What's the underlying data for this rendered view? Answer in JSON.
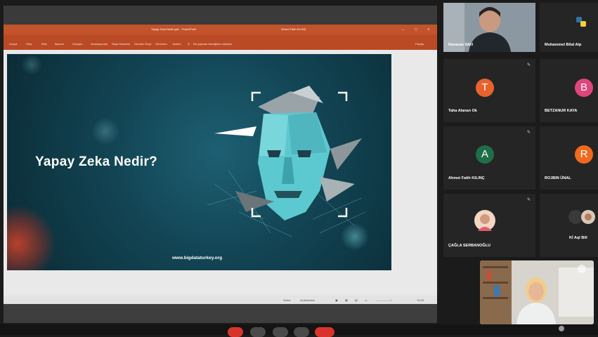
{
  "powerpoint": {
    "title_center": "Yapay Zeka Nedir.pptx - PowerPoint",
    "title_right": "Ahmet Fatih KILINÇ",
    "ribbon_tabs": [
      "Dosya",
      "Giriş",
      "Ekle",
      "Tasarım",
      "Geçişler",
      "Animasyonlar",
      "Slayt Gösterisi",
      "Gözden Geçir",
      "Görünüm",
      "Yardım"
    ],
    "search_hint": "Ne yapmak istediğinizi söyleyin",
    "share_label": "Paylaş"
  },
  "slide": {
    "title": "Yapay Zeka Nedir?",
    "url": "www.bigdataturkey.org"
  },
  "status_bar": {
    "notes": "Notlar",
    "comments": "Açıklamalar",
    "zoom": "%103"
  },
  "participants": [
    {
      "name": "Ramazan SAKI",
      "type": "video"
    },
    {
      "name": "Muhammet Bilal Alp",
      "type": "logo"
    },
    {
      "name": "Taha Alanan Ok",
      "initial": "T",
      "color": "#e8622e"
    },
    {
      "name": "BETZANUR KAYA",
      "initial": "B",
      "color": "#e0457b"
    },
    {
      "name": "Ahmet Fatih KILINÇ",
      "initial": "A",
      "color": "#1f6e4a"
    },
    {
      "name": "ROJBIN ÜNAL",
      "initial": "R",
      "color": "#f06a1d"
    },
    {
      "name": "ÇAĞLA SERBANOĞLU",
      "type": "photo"
    },
    {
      "name": "Kİ Aql Bill",
      "type": "photo"
    }
  ],
  "colors": {
    "ppt_title_bar": "#c2532a",
    "ppt_ribbon": "#b94a25",
    "slide_bg": "#124453",
    "face": "#5cc8cf",
    "leave_button": "#d9342b"
  }
}
